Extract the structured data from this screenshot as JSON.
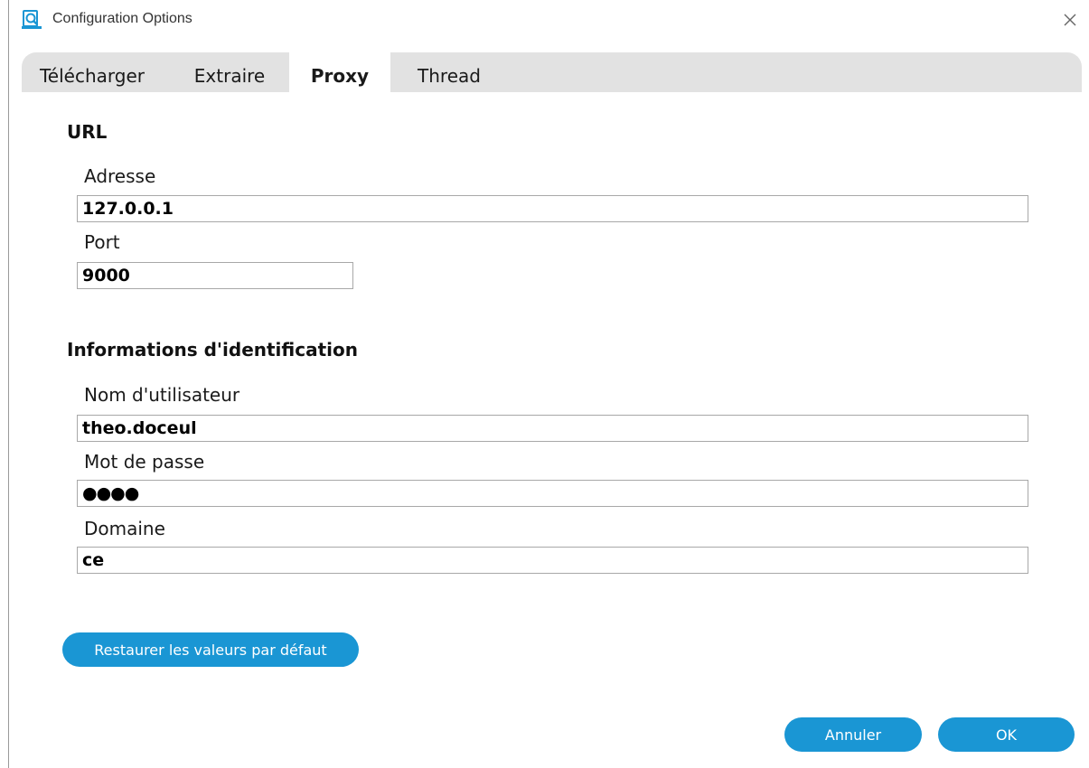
{
  "window": {
    "title": "Configuration Options",
    "accent_color": "#1a96d4"
  },
  "tabs": [
    {
      "label": "Télécharger",
      "active": false
    },
    {
      "label": "Extraire",
      "active": false
    },
    {
      "label": "Proxy",
      "active": true
    },
    {
      "label": "Thread",
      "active": false
    }
  ],
  "url_section": {
    "title": "URL",
    "address_label": "Adresse",
    "address_value": "127.0.0.1",
    "port_label": "Port",
    "port_value": "9000"
  },
  "credentials_section": {
    "title": "Informations d'identification",
    "username_label": "Nom d'utilisateur",
    "username_value": "theo.doceul",
    "password_label": "Mot de passe",
    "password_value": "●●●●",
    "domain_label": "Domaine",
    "domain_value": "ce"
  },
  "buttons": {
    "restore_label": "Restaurer les valeurs par défaut",
    "cancel_label": "Annuler",
    "ok_label": "OK"
  },
  "icons": {
    "app": "magnifier-document-icon",
    "close": "close-icon"
  }
}
